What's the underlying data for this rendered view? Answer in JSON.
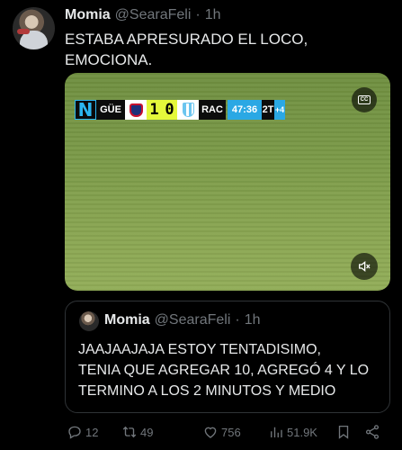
{
  "tweet": {
    "author_name": "Momia",
    "handle": "@SearaFeli",
    "separator": "·",
    "time": "1h",
    "text_line1": "ESTABA APRESURADO EL LOCO,",
    "text_line2": "EMOCIONA."
  },
  "video": {
    "scoreboard": {
      "broadcaster_logo": "N",
      "home_team": "GÜE",
      "home_score": "1",
      "away_score": "0",
      "away_team": "RAC",
      "clock": "47:36",
      "period": "2T",
      "added_time": "+4"
    },
    "cc_label": "CC",
    "icons": {
      "captions": "closed-captions-icon",
      "mute": "speaker-muted-icon"
    }
  },
  "quote": {
    "author_name": "Momia",
    "handle": "@SearaFeli",
    "separator": "·",
    "time": "1h",
    "text_line1": "JAAJAAJAJA ESTOY TENTADISIMO,",
    "text_line2": "TENIA QUE AGREGAR 10, AGREGÓ 4 Y LO",
    "text_line3": "TERMINO A LOS 2 MINUTOS Y MEDIO"
  },
  "actions": {
    "replies": "12",
    "reposts": "49",
    "likes": "756",
    "views": "51.9K"
  },
  "colors": {
    "background": "#000000",
    "text": "#e7e9ea",
    "muted": "#71767b",
    "border": "#2f3336",
    "score_yellow": "#e4f83b",
    "clock_blue": "#2aa8e4"
  }
}
